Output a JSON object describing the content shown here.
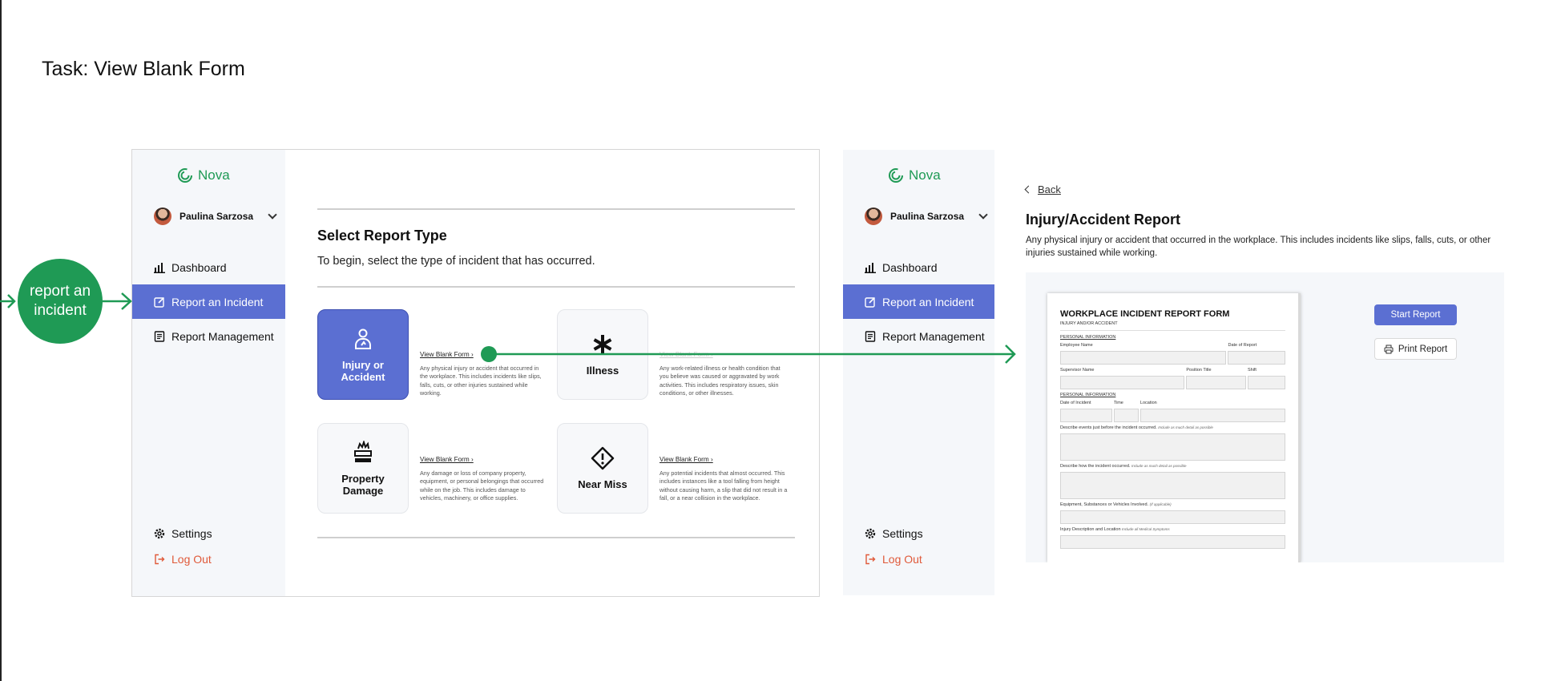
{
  "task_title": "Task: View Blank Form",
  "annotation": {
    "bubble_line1": "report an",
    "bubble_line2": "incident"
  },
  "app": {
    "name": "Nova",
    "brand_color": "#1f9a55",
    "accent_color": "#5b6fd2"
  },
  "user": {
    "name": "Paulina Sarzosa"
  },
  "sidebar": {
    "dashboard": "Dashboard",
    "report_incident": "Report an Incident",
    "report_management": "Report Management",
    "settings": "Settings",
    "logout": "Log Out"
  },
  "select_screen": {
    "title": "Select Report Type",
    "subtitle": "To begin, select the type of incident that has occurred.",
    "cards": [
      {
        "line1": "Injury or",
        "line2": "Accident",
        "icon": "person-injury-icon",
        "link": "View Blank Form ›",
        "desc": "Any physical injury or accident that occurred in the workplace. This includes incidents like slips, falls, cuts, or other injuries sustained while working."
      },
      {
        "line1": "Illness",
        "line2": "",
        "icon": "asterisk-icon",
        "link": "View Blank Form ›",
        "desc": "Any work-related illness or health condition that you believe was caused or aggravated by work activities. This includes respiratory issues, skin conditions, or other illnesses."
      },
      {
        "line1": "Property",
        "line2": "Damage",
        "icon": "damage-icon",
        "link": "View Blank Form ›",
        "desc": "Any damage or loss of company property, equipment, or personal belongings that occurred while on the job. This includes damage to vehicles, machinery, or office supplies."
      },
      {
        "line1": "Near Miss",
        "line2": "",
        "icon": "warning-diamond-icon",
        "link": "View Blank Form ›",
        "desc": "Any potential incidents that almost occurred. This includes instances like a tool falling from height without causing harm, a slip that did not result in a fall, or a near collision in the workplace."
      }
    ]
  },
  "report_screen": {
    "back": "Back",
    "title": "Injury/Accident Report",
    "description": "Any physical injury or accident that occurred in the workplace. This includes incidents like slips, falls, cuts, or other injuries sustained while working.",
    "start_button": "Start Report",
    "print_button": "Print Report",
    "form": {
      "title": "WORKPLACE INCIDENT REPORT FORM",
      "subtitle": "INJURY AND/OR ACCIDENT",
      "section1": "PERSONAL INFORMATION",
      "employee_name": "Employee Name",
      "date_of_report": "Date of Report",
      "supervisor_name": "Supervisor Name",
      "position_title": "Position Title",
      "shift": "Shift",
      "section2": "PERSONAL INFORMATION",
      "date_of_incident": "Date of Incident",
      "time": "Time",
      "location": "Location",
      "events_before": "Describe events just before the incident occurred.",
      "events_before_hint": "Include as much detail as possible",
      "how_occurred": "Describe how the incident occurred.",
      "how_occurred_hint": "Include as much detail as possible",
      "equipment": "Equipment, Substances or Vehicles Involved.",
      "equipment_hint": "(If applicable)",
      "injury_desc": "Injury Description and Location",
      "injury_desc_hint": "Include all Medical Symptoms"
    }
  }
}
